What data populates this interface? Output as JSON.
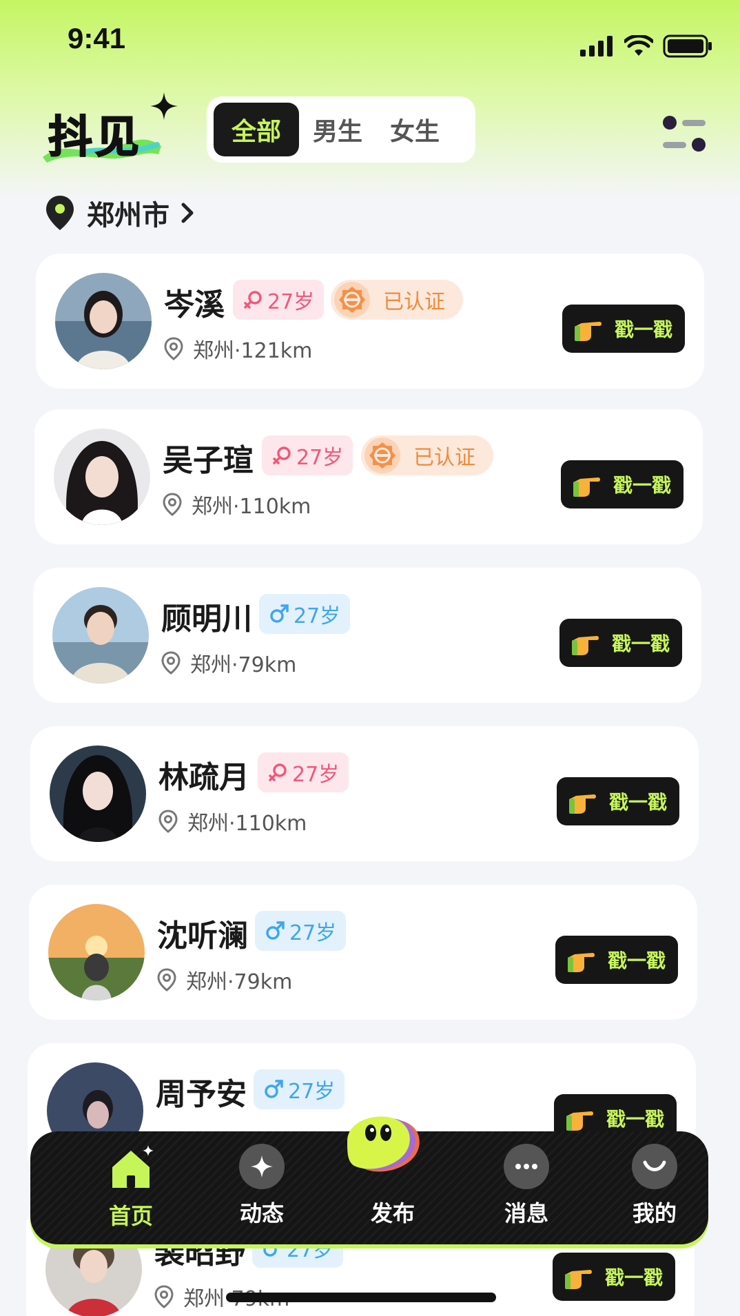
{
  "status_bar": {
    "time": "9:41"
  },
  "header": {
    "logo_text": "抖见",
    "tabs": [
      {
        "label": "全部",
        "active": true
      },
      {
        "label": "男生",
        "active": false
      },
      {
        "label": "女生",
        "active": false
      }
    ]
  },
  "location": {
    "city": "郑州市"
  },
  "users": [
    {
      "name": "岑溪",
      "gender": "female",
      "age": "27岁",
      "verified": true,
      "verified_label": "已认证",
      "location": "郑州·121km",
      "button": "戳一戳"
    },
    {
      "name": "吴子瑄",
      "gender": "female",
      "age": "27岁",
      "verified": true,
      "verified_label": "已认证",
      "location": "郑州·110km",
      "button": "戳一戳"
    },
    {
      "name": "顾明川",
      "gender": "male",
      "age": "27岁",
      "verified": false,
      "location": "郑州·79km",
      "button": "戳一戳"
    },
    {
      "name": "林疏月",
      "gender": "female",
      "age": "27岁",
      "verified": false,
      "location": "郑州·110km",
      "button": "戳一戳"
    },
    {
      "name": "沈听澜",
      "gender": "male",
      "age": "27岁",
      "verified": false,
      "location": "郑州·79km",
      "button": "戳一戳"
    },
    {
      "name": "周予安",
      "gender": "male",
      "age": "27岁",
      "verified": false,
      "location": "",
      "button": "戳一戳"
    },
    {
      "name": "裴昭野",
      "gender": "male",
      "age": "27岁",
      "verified": false,
      "location": "郑州·79km",
      "button": "戳一戳"
    }
  ],
  "bottom_nav": [
    {
      "label": "首页",
      "icon": "home-icon",
      "active": true
    },
    {
      "label": "动态",
      "icon": "sparkle-icon",
      "active": false
    },
    {
      "label": "发布",
      "icon": "publish-icon",
      "active": false
    },
    {
      "label": "消息",
      "icon": "chat-icon",
      "active": false
    },
    {
      "label": "我的",
      "icon": "profile-icon",
      "active": false
    }
  ],
  "colors": {
    "accent": "#c6f55a",
    "dark": "#161616",
    "female": "#f0587a",
    "male": "#3ea6ee",
    "verified": "#f08a3c"
  }
}
